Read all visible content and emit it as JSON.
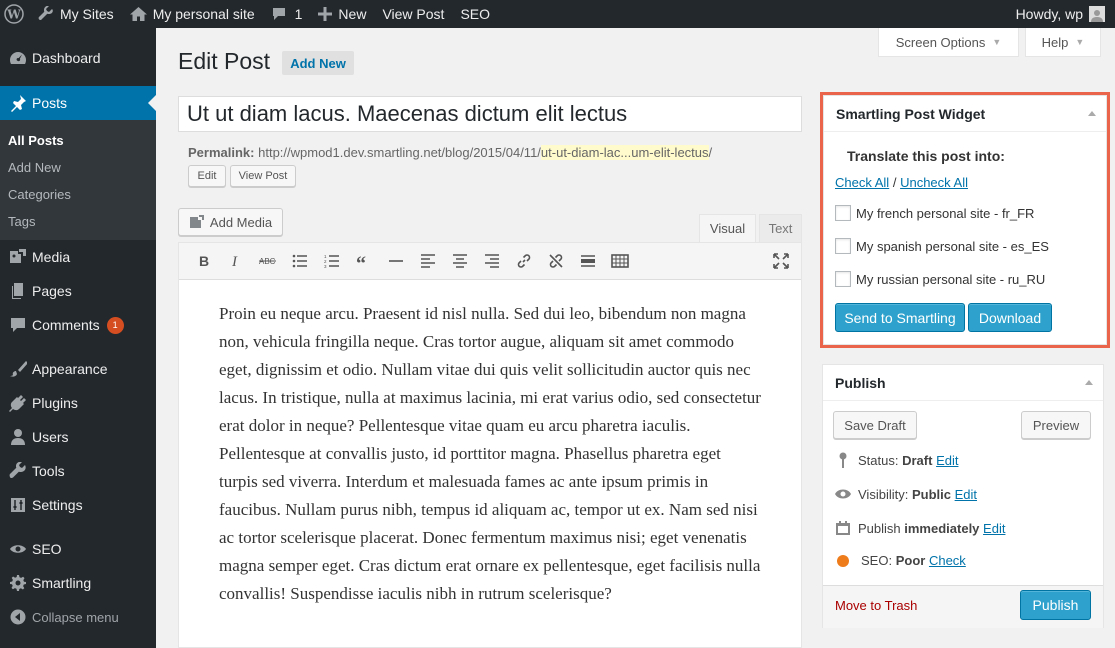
{
  "adminbar": {
    "my_sites": "My Sites",
    "site_name": "My personal site",
    "comments_count": "1",
    "new": "New",
    "view_post": "View Post",
    "seo": "SEO",
    "howdy": "Howdy, wp"
  },
  "sidebar": {
    "dashboard": "Dashboard",
    "posts": "Posts",
    "posts_sub": [
      "All Posts",
      "Add New",
      "Categories",
      "Tags"
    ],
    "media": "Media",
    "pages": "Pages",
    "comments": "Comments",
    "comments_badge": "1",
    "appearance": "Appearance",
    "plugins": "Plugins",
    "users": "Users",
    "tools": "Tools",
    "settings": "Settings",
    "seo": "SEO",
    "smartling": "Smartling",
    "collapse": "Collapse menu"
  },
  "screen_options": "Screen Options",
  "help": "Help",
  "page": {
    "title": "Edit Post",
    "add_new": "Add New",
    "post_title": "Ut ut diam lacus. Maecenas dictum elit lectus",
    "permalink_label": "Permalink:",
    "permalink_base": "http://wpmod1.dev.smartling.net/blog/2015/04/11/",
    "permalink_slug": "ut-ut-diam-lac...um-elit-lectus",
    "permalink_end": "/",
    "edit_btn": "Edit",
    "view_post_btn": "View Post",
    "add_media": "Add Media",
    "tab_visual": "Visual",
    "tab_text": "Text",
    "body_text": "Proin eu neque arcu. Praesent id nisl nulla. Sed dui leo, bibendum non magna non, vehicula fringilla neque. Cras tortor augue, aliquam sit amet commodo eget, dignissim et odio. Nullam vitae dui quis velit sollicitudin auctor quis nec lacus. In tristique, nulla at maximus lacinia, mi erat varius odio, sed consectetur erat dolor in neque? Pellentesque vitae quam eu arcu pharetra iaculis. Pellentesque at convallis justo, id porttitor magna. Phasellus pharetra eget turpis sed viverra. Interdum et malesuada fames ac ante ipsum primis in faucibus. Nullam purus nibh, tempus id aliquam ac, tempor ut ex. Nam sed nisi ac tortor scelerisque placerat. Donec fermentum maximus nisi; eget venenatis magna semper eget. Cras dictum erat ornare ex pellentesque, eget facilisis nulla convallis! Suspendisse iaculis nibh in rutrum scelerisque?"
  },
  "smartling": {
    "title": "Smartling Post Widget",
    "translate_label": "Translate this post into:",
    "check_all": "Check All",
    "separator": "/",
    "uncheck_all": "Uncheck All",
    "sites": [
      "My french personal site - fr_FR",
      "My spanish personal site - es_ES",
      "My russian personal site - ru_RU"
    ],
    "send_btn": "Send to Smartling",
    "download_btn": "Download"
  },
  "publish": {
    "title": "Publish",
    "save_draft": "Save Draft",
    "preview": "Preview",
    "status_label": "Status:",
    "status_value": "Draft",
    "visibility_label": "Visibility:",
    "visibility_value": "Public",
    "publish_label": "Publish",
    "publish_value": "immediately",
    "seo_label": "SEO:",
    "seo_value": "Poor",
    "seo_link": "Check",
    "edit_link": "Edit",
    "trash": "Move to Trash",
    "publish_btn": "Publish"
  }
}
